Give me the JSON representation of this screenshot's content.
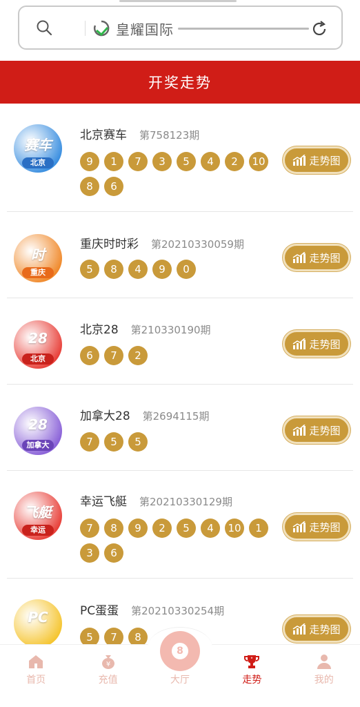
{
  "browser": {
    "site_name": "皇耀国际"
  },
  "header": {
    "title": "开奖走势"
  },
  "games": [
    {
      "name": "北京赛车",
      "issue": "第758123期",
      "logo_text": "赛车",
      "logo_tag": "北京",
      "logo_color": "#3b8fe0",
      "tag_color": "#2a6fc4",
      "balls": [
        "9",
        "1",
        "7",
        "3",
        "5",
        "4",
        "2",
        "10",
        "8",
        "6"
      ],
      "trend_label": "走势图"
    },
    {
      "name": "重庆时时彩",
      "issue": "第20210330059期",
      "logo_text": "时",
      "logo_tag": "重庆",
      "logo_color": "#f08a2c",
      "tag_color": "#e86a1a",
      "balls": [
        "5",
        "8",
        "4",
        "9",
        "0"
      ],
      "trend_label": "走势图"
    },
    {
      "name": "北京28",
      "issue": "第210330190期",
      "logo_text": "28",
      "logo_tag": "北京",
      "logo_color": "#e8413a",
      "tag_color": "#c9221c",
      "balls": [
        "6",
        "7",
        "2"
      ],
      "trend_label": "走势图"
    },
    {
      "name": "加拿大28",
      "issue": "第2694115期",
      "logo_text": "28",
      "logo_tag": "加拿大",
      "logo_color": "#8a62d8",
      "tag_color": "#6a44b8",
      "balls": [
        "7",
        "5",
        "5"
      ],
      "trend_label": "走势图"
    },
    {
      "name": "幸运飞艇",
      "issue": "第20210330129期",
      "logo_text": "飞艇",
      "logo_tag": "幸运",
      "logo_color": "#e8413a",
      "tag_color": "#c9221c",
      "balls": [
        "7",
        "8",
        "9",
        "2",
        "5",
        "4",
        "10",
        "1",
        "3",
        "6"
      ],
      "trend_label": "走势图"
    },
    {
      "name": "PC蛋蛋",
      "issue": "第20210330254期",
      "logo_text": "PC",
      "logo_tag": "",
      "logo_color": "#f5c531",
      "tag_color": "#e0a810",
      "balls": [
        "5",
        "7",
        "8"
      ],
      "trend_label": "走势图"
    }
  ],
  "nav": {
    "items": [
      {
        "label": "首页",
        "icon": "home-icon"
      },
      {
        "label": "充值",
        "icon": "money-bag-icon"
      },
      {
        "label": "大厅",
        "icon": "billiard-ball-icon"
      },
      {
        "label": "走势",
        "icon": "trophy-icon"
      },
      {
        "label": "我的",
        "icon": "user-icon"
      }
    ],
    "active": "走势",
    "center_ball_text": "8"
  },
  "colors": {
    "primary_red": "#d01d17",
    "gold": "#c99a3a",
    "nav_inactive": "#e8b8ad"
  }
}
